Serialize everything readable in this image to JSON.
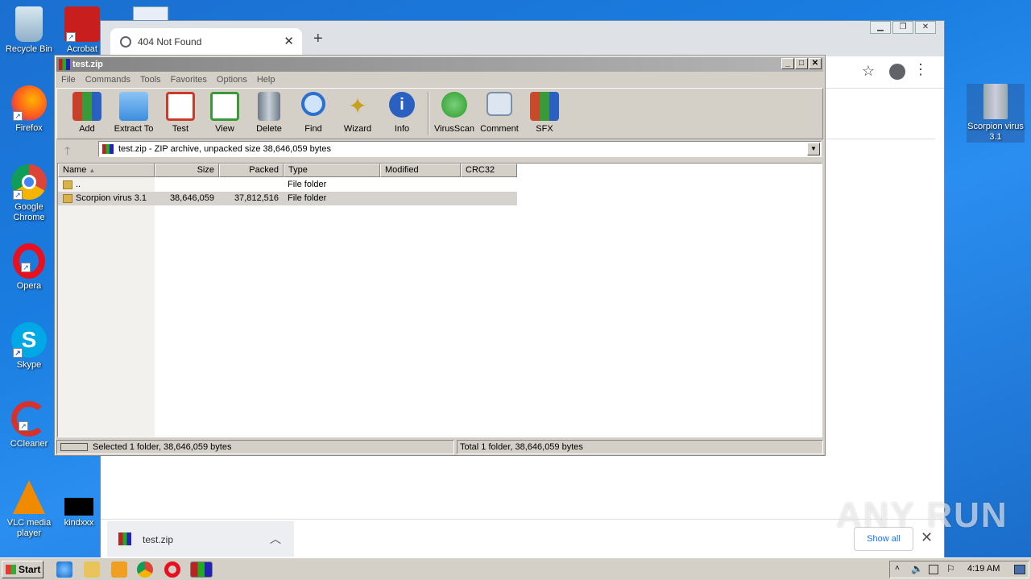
{
  "desktop": {
    "icons": [
      {
        "label": "Recycle Bin"
      },
      {
        "label": "Acrobat"
      },
      {
        "label": "Firefox"
      },
      {
        "label": "Google Chrome"
      },
      {
        "label": "Opera"
      },
      {
        "label": "Skype"
      },
      {
        "label": "CCleaner"
      },
      {
        "label": "VLC media player"
      },
      {
        "label": "kindxxx"
      },
      {
        "label": "Scorpion virus 3.1"
      }
    ]
  },
  "chrome": {
    "tab_title": "404 Not Found",
    "new_tab_glyph": "+",
    "download_item": "test.zip",
    "show_all": "Show all"
  },
  "winrar": {
    "title": "test.zip",
    "menu": [
      "File",
      "Commands",
      "Tools",
      "Favorites",
      "Options",
      "Help"
    ],
    "toolbar": [
      {
        "label": "Add",
        "icon": "add-books-icon",
        "color": "#c8402a"
      },
      {
        "label": "Extract To",
        "icon": "folder-icon",
        "color": "#3c8ee0"
      },
      {
        "label": "Test",
        "icon": "clipboard-check-icon",
        "color": "#cc3a2a"
      },
      {
        "label": "View",
        "icon": "book-icon",
        "color": "#3a9a3a"
      },
      {
        "label": "Delete",
        "icon": "trash-icon",
        "color": "#8c9aa8"
      },
      {
        "label": "Find",
        "icon": "magnifier-icon",
        "color": "#2a70d0"
      },
      {
        "label": "Wizard",
        "icon": "wand-icon",
        "color": "#c8a020"
      },
      {
        "label": "Info",
        "icon": "info-icon",
        "color": "#2a60c0"
      },
      {
        "label": "VirusScan",
        "icon": "bug-icon",
        "color": "#2a9a2a"
      },
      {
        "label": "Comment",
        "icon": "comment-icon",
        "color": "#7890a8"
      },
      {
        "label": "SFX",
        "icon": "sfx-icon",
        "color": "#c84a2a"
      }
    ],
    "path": "test.zip - ZIP archive, unpacked size 38,646,059 bytes",
    "columns": [
      "Name",
      "Size",
      "Packed",
      "Type",
      "Modified",
      "CRC32"
    ],
    "rows": [
      {
        "name": "..",
        "size": "",
        "packed": "",
        "type": "File folder"
      },
      {
        "name": "Scorpion virus 3.1",
        "size": "38,646,059",
        "packed": "37,812,516",
        "type": "File folder"
      }
    ],
    "status_left": "Selected 1 folder, 38,646,059 bytes",
    "status_right": "Total 1 folder, 38,646,059 bytes"
  },
  "taskbar": {
    "start": "Start",
    "clock": "4:19 AM"
  },
  "watermark": "ANY RUN"
}
